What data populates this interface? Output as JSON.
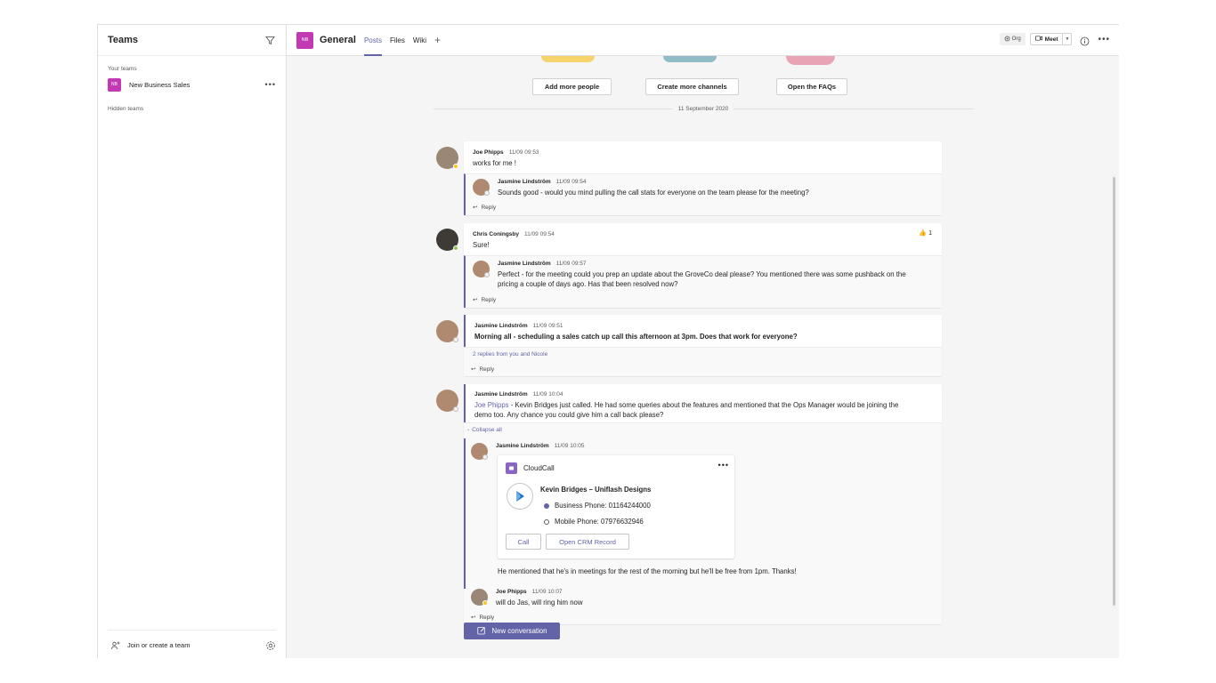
{
  "left": {
    "title": "Teams",
    "your_teams_label": "Your teams",
    "team": {
      "initials": "NB",
      "name": "New Business Sales"
    },
    "hidden_label": "Hidden teams",
    "join_label": "Join or create a team"
  },
  "topbar": {
    "channel_initials": "NB",
    "channel_name": "General",
    "tabs": [
      "Posts",
      "Files",
      "Wiki"
    ],
    "org_label": "Org",
    "meet_label": "Meet"
  },
  "welcome": {
    "buttons": [
      "Add more people",
      "Create more channels",
      "Open the FAQs"
    ]
  },
  "date_divider": "11 September 2020",
  "reply_label": "Reply",
  "threads": [
    {
      "author": "Joe Phipps",
      "time": "11/09 09:53",
      "body": "works for me !",
      "replies": [
        {
          "author": "Jasmine Lindström",
          "time": "11/09 09:54",
          "body": "Sounds good - would you mind pulling the call stats for everyone on the team please for the meeting?"
        }
      ]
    },
    {
      "author": "Chris Coningsby",
      "time": "11/09 09:54",
      "body": "Sure!",
      "reaction_count": "1",
      "replies": [
        {
          "author": "Jasmine Lindström",
          "time": "11/09 09:57",
          "body_line1": "Perfect - for the meeting could you prep an update about the GroveCo deal please? You mentioned there was some pushback on the",
          "body_line2": "pricing a couple of days ago. Has that been resolved now?"
        }
      ]
    },
    {
      "author": "Jasmine Lindström",
      "time": "11/09 09:51",
      "body": "Morning all - scheduling a sales catch up call this afternoon at 3pm. Does that work for everyone?",
      "replies_summary": "2 replies from you and Nicole"
    },
    {
      "author": "Jasmine Lindström",
      "time": "11/09 10:04",
      "mention": "Joe Phipps",
      "body_line1": " - Kevin Bridges just called. He had some queries about the features and mentioned that the Ops Manager would be joining the",
      "body_line2": "demo too. Any chance you could give him a call back please?",
      "collapse_label": "Collapse all",
      "reply1": {
        "author": "Jasmine Lindström",
        "time": "11/09 10:05",
        "followup": "He mentioned that he's in meetings for the rest of the morning but he'll be free from 1pm. Thanks!"
      },
      "card": {
        "app_name": "CloudCall",
        "contact": "Kevin Bridges – Uniflash Designs",
        "business_phone": "Business Phone: 01164244000",
        "mobile_phone": "Mobile Phone: 07976632946",
        "call_button": "Call",
        "crm_button": "Open CRM Record"
      },
      "reply2": {
        "author": "Joe Phipps",
        "time": "11/09 10:07",
        "body": "will do Jas, will ring him now"
      }
    }
  ],
  "new_conversation_label": "New conversation",
  "colors": {
    "accent": "#6264a7",
    "team_avatar": "#c239b3",
    "available": "#92c353",
    "away": "#fcc419"
  },
  "icons": [
    "filter-icon",
    "more-icon",
    "join-team-icon",
    "gear-icon",
    "add-tab-icon",
    "org-icon",
    "meet-camera-icon",
    "chevron-down-icon",
    "info-icon",
    "reply-icon",
    "thumbs-up-icon",
    "cloudcall-icon",
    "edit-icon"
  ]
}
